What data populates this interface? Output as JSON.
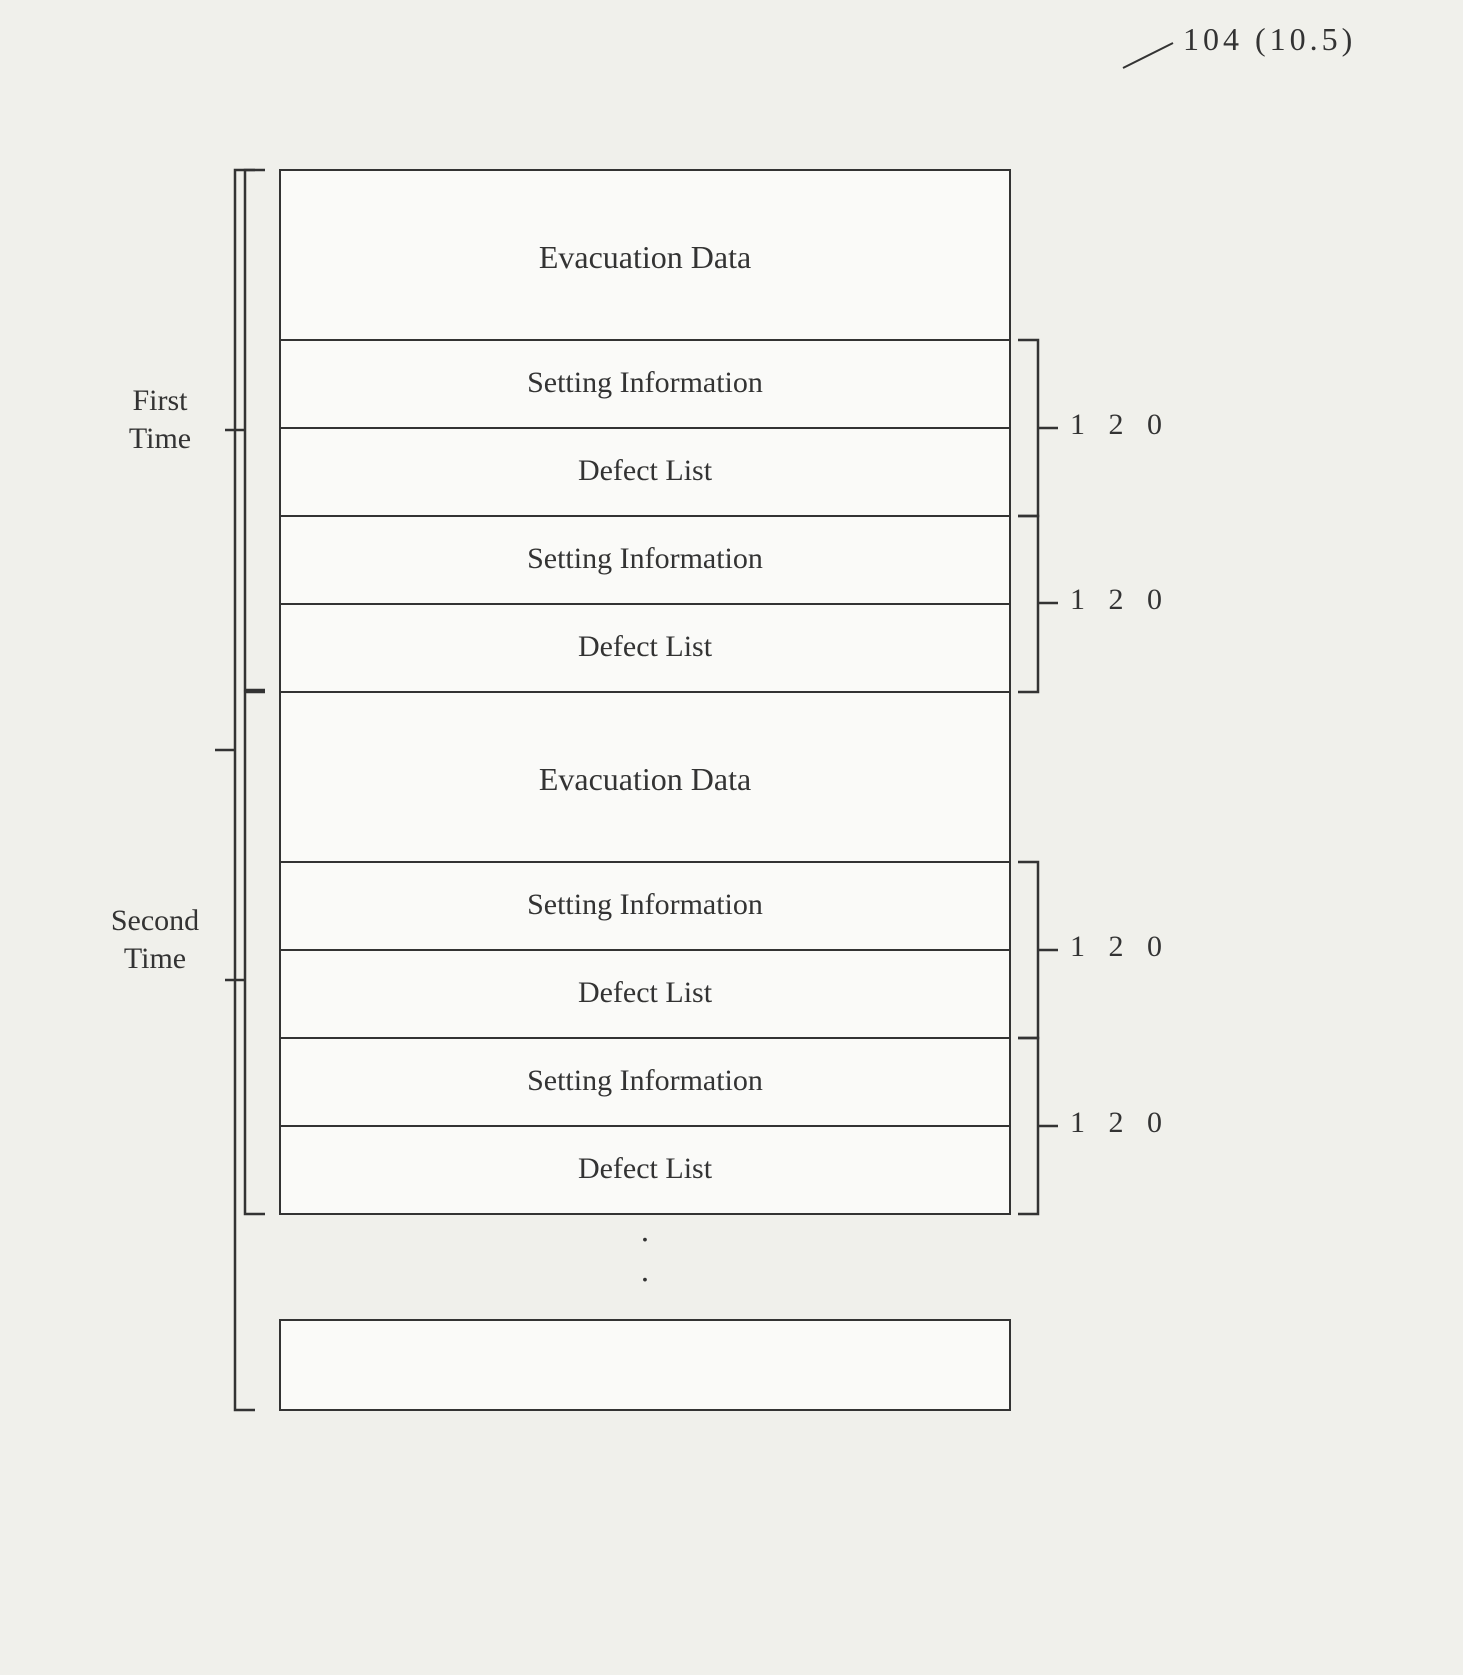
{
  "ref": {
    "number": "104 (10.5)",
    "arrow_label": "arrow"
  },
  "blocks": [
    {
      "id": "evac1",
      "label": "Evacuation Data",
      "size": "tall"
    },
    {
      "id": "setting1a",
      "label": "Setting Information",
      "size": "medium"
    },
    {
      "id": "defect1a",
      "label": "Defect List",
      "size": "medium"
    },
    {
      "id": "setting1b",
      "label": "Setting Information",
      "size": "medium"
    },
    {
      "id": "defect1b",
      "label": "Defect List",
      "size": "medium"
    },
    {
      "id": "evac2",
      "label": "Evacuation Data",
      "size": "tall"
    },
    {
      "id": "setting2a",
      "label": "Setting Information",
      "size": "medium"
    },
    {
      "id": "defect2a",
      "label": "Defect List",
      "size": "medium"
    },
    {
      "id": "setting2b",
      "label": "Setting Information",
      "size": "medium"
    },
    {
      "id": "defect2b",
      "label": "Defect List",
      "size": "medium"
    },
    {
      "id": "bottom",
      "label": "",
      "size": "bottom-empty"
    }
  ],
  "labels": {
    "first_time": "First\nTime",
    "second_time": "Second\nTime"
  },
  "numbers": {
    "n120_1": "1 2 0",
    "n120_2": "1 2 0",
    "n120_3": "1 2 0",
    "n120_4": "1 2 0"
  },
  "dots": [
    "·",
    "·"
  ]
}
